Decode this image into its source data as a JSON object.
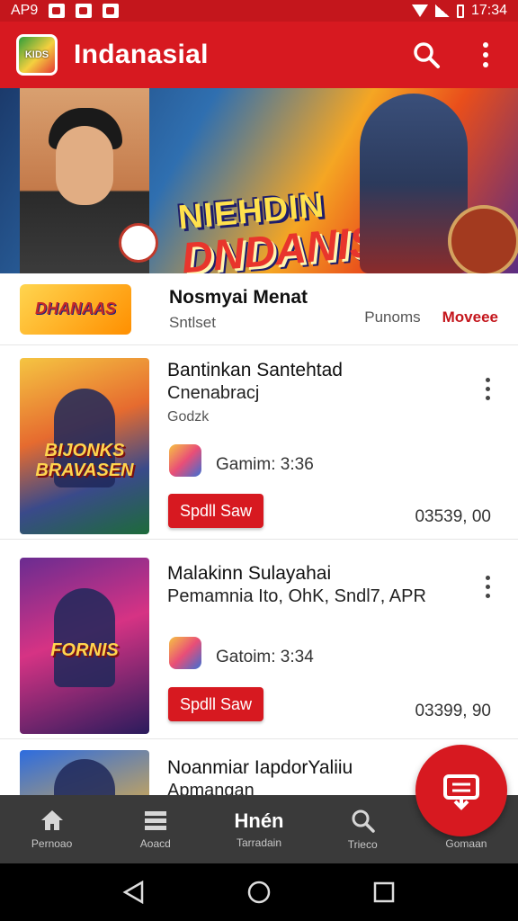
{
  "status_bar": {
    "left_text": "AP9",
    "time": "17:34"
  },
  "app_bar": {
    "title": "Indanasial",
    "logo_text": "KIDS"
  },
  "hero": {
    "line1": "NIEHDIN",
    "line2": "DNDANISE!"
  },
  "publisher": {
    "logo_text": "DHANAAS",
    "name": "Nosmyai Menat",
    "subtitle": "Sntlset",
    "tabs": [
      "Punoms",
      "Moveee"
    ],
    "active_tab": "Moveee"
  },
  "games": [
    {
      "thumb_title": "BIJONKS BRAVASEN",
      "title": "Bantinkan Santehtad",
      "subtitle": "Cnenabracj",
      "size": "Godzk",
      "genre": "Gamim: 3:36",
      "button_label": "Spdll Saw",
      "price": "03539, 00"
    },
    {
      "thumb_title": "FORNIS",
      "title": "Malakinn Sulayahai",
      "subtitle": "Pemamnia Ito, OhK, Sndl7, APR",
      "size": "",
      "genre": "Gatoim: 3:34",
      "button_label": "Spdll Saw",
      "price": "03399, 90"
    },
    {
      "thumb_title": "",
      "title": "Noanmiar IapdorYaliiu",
      "subtitle": "Apmangan",
      "size": "",
      "genre": "",
      "button_label": "",
      "price": ""
    }
  ],
  "bottom_nav": [
    {
      "icon": "home-icon",
      "label": "Pernoao"
    },
    {
      "icon": "list-icon",
      "label": "Aoacd"
    },
    {
      "icon": "text-mark",
      "big": "Hnén",
      "label": "Tarradain"
    },
    {
      "icon": "search-icon",
      "label": "Trieco"
    },
    {
      "icon": "profile-icon",
      "label": "Gomaan"
    }
  ],
  "colors": {
    "primary": "#d71920",
    "status_bar": "#c4161c",
    "nav_bg": "#3a3a3a"
  }
}
